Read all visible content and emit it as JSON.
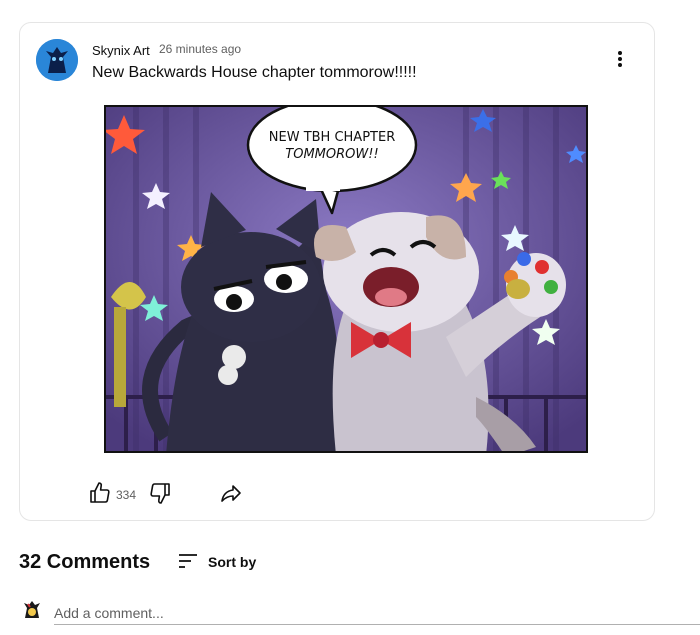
{
  "post": {
    "author": "Skynix Art",
    "time": "26 minutes ago",
    "text": "New Backwards House chapter tommorow!!!!!",
    "image": {
      "speech_line1": "NEW TBH CHAPTER",
      "speech_line2": "TOMMOROW!!"
    },
    "likes": "334",
    "icons": {
      "menu": "more-vert-icon",
      "like": "thumb-up-icon",
      "dislike": "thumb-down-icon",
      "share": "share-icon"
    }
  },
  "comments": {
    "count_label": "32 Comments",
    "sort_label": "Sort by",
    "add_placeholder": "Add a comment..."
  },
  "colors": {
    "text_primary": "#0f0f0f",
    "text_secondary": "#606060",
    "card_border": "#e5e5e5"
  }
}
